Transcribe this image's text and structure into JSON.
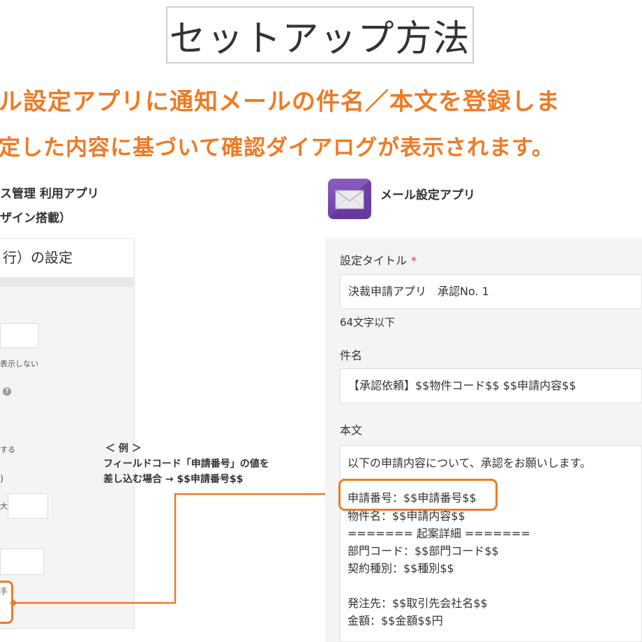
{
  "page": {
    "title": "セットアップ方法",
    "headline_1": "ル設定アプリに通知メールの件名／本文を登録しま",
    "headline_2": "定した内容に基づいて確認ダイアログが表示されます。"
  },
  "colors": {
    "accent": "#f07a24",
    "mail_icon": "#7a4bb6",
    "required": "#e33333"
  },
  "left_app": {
    "name": "ス管理 利用アプリ",
    "subtitle": "ザイン搭載）",
    "panel_title": "行）の設定",
    "fragments": [
      "表示しない",
      "する",
      ")",
      "大",
      "手"
    ],
    "help_icon": "?"
  },
  "annotation": {
    "line_1": "＜ 例 ＞",
    "line_2": "フィールドコード「申請番号」の値を",
    "line_3": "差し込む場合 → $$申請番号$$"
  },
  "right_app": {
    "name": "メール設定アプリ",
    "icon": "mail-icon",
    "form": {
      "title_label": "設定タイトル",
      "required_mark": "*",
      "title_value": "決裁申請アプリ　承認No. 1",
      "title_hint": "64文字以下",
      "subject_label": "件名",
      "subject_value": "【承認依頼】$$物件コード$$ $$申請内容$$",
      "body_label": "本文",
      "body_lines": [
        "以下の申請内容について、承認をお願いします。",
        "申請番号：$$申請番号$$",
        "物件名：$$申請内容$$",
        "======= 起案詳細 =======",
        "部門コード：$$部門コード$$",
        "契約種別：$$種別$$",
        "発注先：$$取引先会社名$$",
        "金額：$$金額$$円"
      ]
    }
  }
}
